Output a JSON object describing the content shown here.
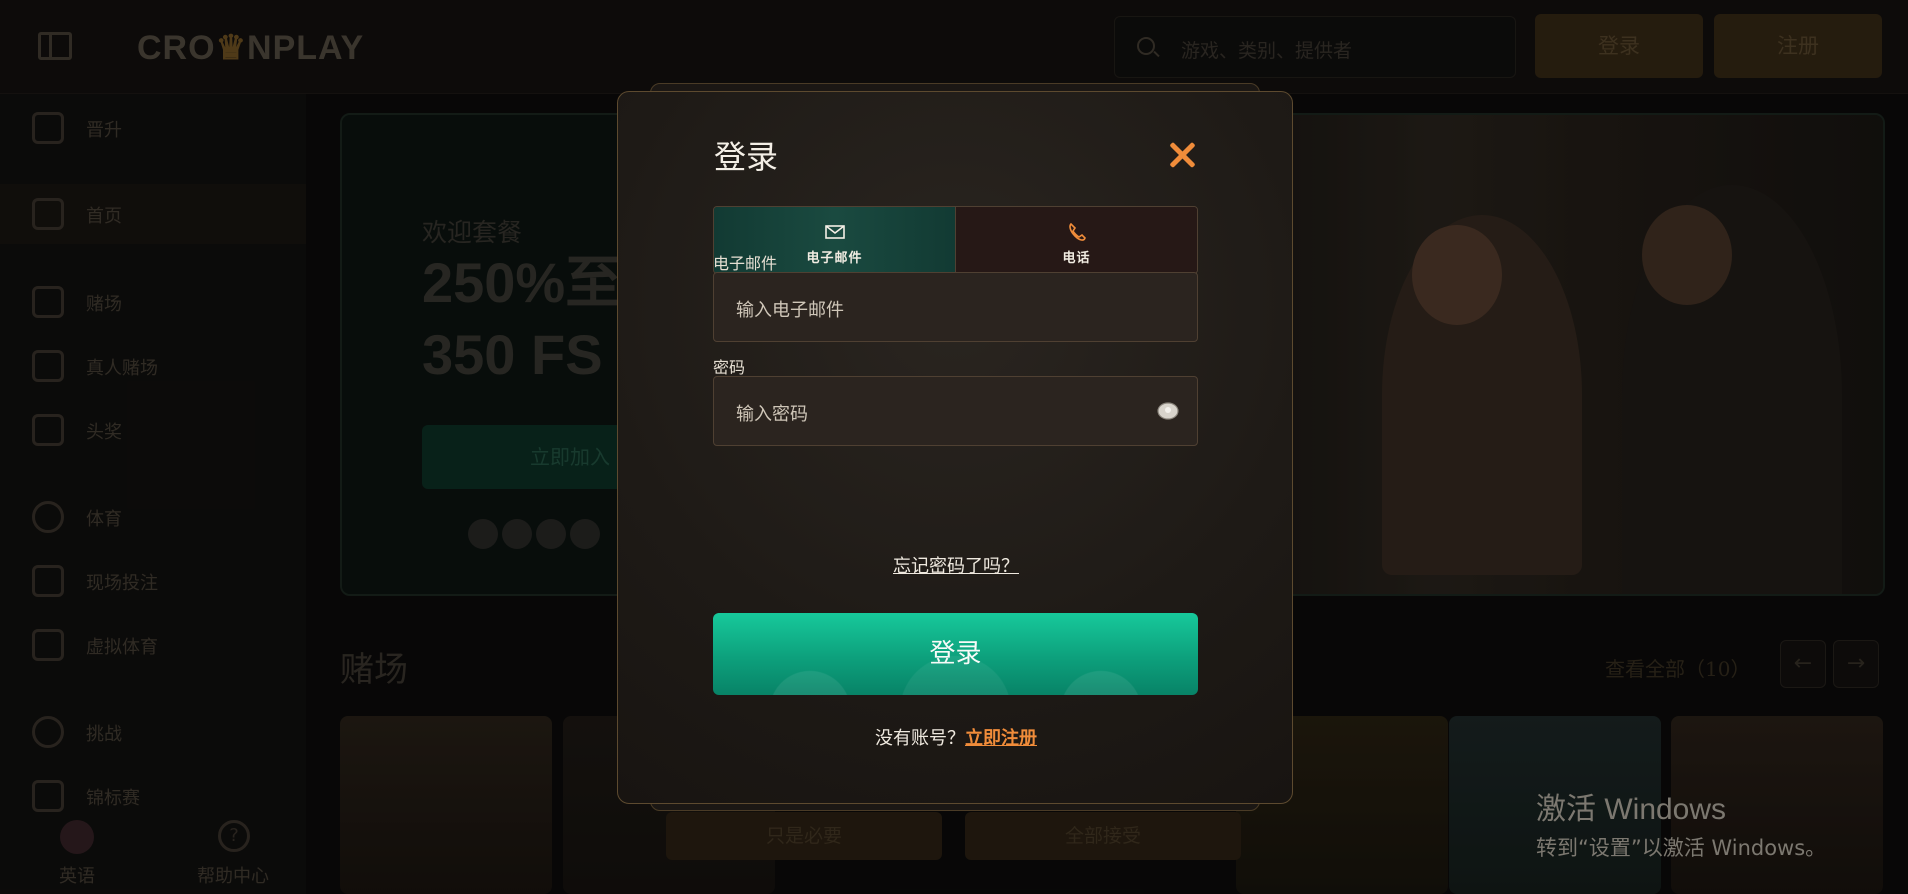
{
  "header": {
    "logo_text_left": "CRO",
    "logo_crown": "♛",
    "logo_text_right": "NPLAY",
    "search_placeholder": "游戏、类别、提供者",
    "login_label": "登录",
    "signup_label": "注册"
  },
  "sidebar": {
    "items": [
      {
        "label": "晋升",
        "icon": "gift-icon"
      },
      {
        "label": "首页",
        "icon": "home-icon"
      },
      {
        "label": "赌场",
        "icon": "slot-machine-icon"
      },
      {
        "label": "真人赌场",
        "icon": "spade-icon"
      },
      {
        "label": "头奖",
        "icon": "clover-icon"
      },
      {
        "label": "体育",
        "icon": "ball-icon"
      },
      {
        "label": "现场投注",
        "icon": "live-bet-icon"
      },
      {
        "label": "虚拟体育",
        "icon": "gamepad-icon"
      },
      {
        "label": "挑战",
        "icon": "medal-icon"
      },
      {
        "label": "锦标赛",
        "icon": "trophy-icon"
      }
    ],
    "language_label": "英语",
    "help_label": "帮助中心",
    "help_glyph": "?"
  },
  "banner": {
    "subtitle": "欢迎套餐",
    "headline_line1": "250%至",
    "headline_line2": "350 FS",
    "cta_label": "立即加入"
  },
  "casino_section": {
    "title": "赌场",
    "view_all": "查看全部（10）",
    "prev_glyph": "←",
    "next_glyph": "→"
  },
  "cookie_bar": {
    "essential_label": "只是必要",
    "accept_all_label": "全部接受"
  },
  "windows_watermark": {
    "line1": "激活 Windows",
    "line2": "转到“设置”以激活 Windows。"
  },
  "login_modal": {
    "title": "登录",
    "tabs": [
      {
        "label": "电子邮件",
        "icon": "envelope-icon",
        "active": true
      },
      {
        "label": "电话",
        "icon": "phone-icon",
        "active": false
      }
    ],
    "email_label": "电子邮件",
    "email_placeholder": "输入电子邮件",
    "password_label": "密码",
    "password_placeholder": "输入密码",
    "forgot_password": "忘记密码了吗？",
    "submit_label": "登录",
    "no_account_text": "没有账号？",
    "register_link": "立即注册",
    "accent_color": "#f08c3a",
    "button_color": "#12b48c"
  }
}
